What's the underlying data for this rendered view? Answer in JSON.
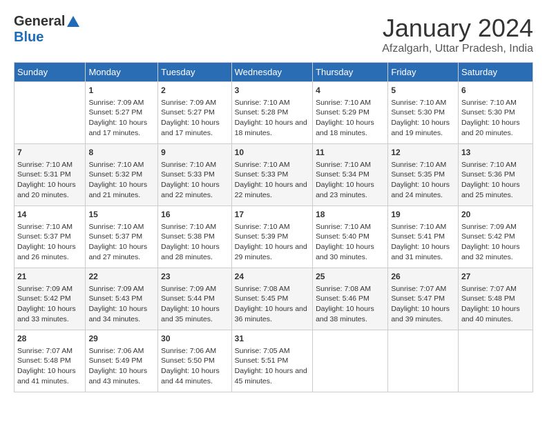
{
  "header": {
    "logo_general": "General",
    "logo_blue": "Blue",
    "title": "January 2024",
    "subtitle": "Afzalgarh, Uttar Pradesh, India"
  },
  "columns": [
    "Sunday",
    "Monday",
    "Tuesday",
    "Wednesday",
    "Thursday",
    "Friday",
    "Saturday"
  ],
  "weeks": [
    [
      {
        "day": "",
        "sunrise": "",
        "sunset": "",
        "daylight": ""
      },
      {
        "day": "1",
        "sunrise": "Sunrise: 7:09 AM",
        "sunset": "Sunset: 5:27 PM",
        "daylight": "Daylight: 10 hours and 17 minutes."
      },
      {
        "day": "2",
        "sunrise": "Sunrise: 7:09 AM",
        "sunset": "Sunset: 5:27 PM",
        "daylight": "Daylight: 10 hours and 17 minutes."
      },
      {
        "day": "3",
        "sunrise": "Sunrise: 7:10 AM",
        "sunset": "Sunset: 5:28 PM",
        "daylight": "Daylight: 10 hours and 18 minutes."
      },
      {
        "day": "4",
        "sunrise": "Sunrise: 7:10 AM",
        "sunset": "Sunset: 5:29 PM",
        "daylight": "Daylight: 10 hours and 18 minutes."
      },
      {
        "day": "5",
        "sunrise": "Sunrise: 7:10 AM",
        "sunset": "Sunset: 5:30 PM",
        "daylight": "Daylight: 10 hours and 19 minutes."
      },
      {
        "day": "6",
        "sunrise": "Sunrise: 7:10 AM",
        "sunset": "Sunset: 5:30 PM",
        "daylight": "Daylight: 10 hours and 20 minutes."
      }
    ],
    [
      {
        "day": "7",
        "sunrise": "Sunrise: 7:10 AM",
        "sunset": "Sunset: 5:31 PM",
        "daylight": "Daylight: 10 hours and 20 minutes."
      },
      {
        "day": "8",
        "sunrise": "Sunrise: 7:10 AM",
        "sunset": "Sunset: 5:32 PM",
        "daylight": "Daylight: 10 hours and 21 minutes."
      },
      {
        "day": "9",
        "sunrise": "Sunrise: 7:10 AM",
        "sunset": "Sunset: 5:33 PM",
        "daylight": "Daylight: 10 hours and 22 minutes."
      },
      {
        "day": "10",
        "sunrise": "Sunrise: 7:10 AM",
        "sunset": "Sunset: 5:33 PM",
        "daylight": "Daylight: 10 hours and 22 minutes."
      },
      {
        "day": "11",
        "sunrise": "Sunrise: 7:10 AM",
        "sunset": "Sunset: 5:34 PM",
        "daylight": "Daylight: 10 hours and 23 minutes."
      },
      {
        "day": "12",
        "sunrise": "Sunrise: 7:10 AM",
        "sunset": "Sunset: 5:35 PM",
        "daylight": "Daylight: 10 hours and 24 minutes."
      },
      {
        "day": "13",
        "sunrise": "Sunrise: 7:10 AM",
        "sunset": "Sunset: 5:36 PM",
        "daylight": "Daylight: 10 hours and 25 minutes."
      }
    ],
    [
      {
        "day": "14",
        "sunrise": "Sunrise: 7:10 AM",
        "sunset": "Sunset: 5:37 PM",
        "daylight": "Daylight: 10 hours and 26 minutes."
      },
      {
        "day": "15",
        "sunrise": "Sunrise: 7:10 AM",
        "sunset": "Sunset: 5:37 PM",
        "daylight": "Daylight: 10 hours and 27 minutes."
      },
      {
        "day": "16",
        "sunrise": "Sunrise: 7:10 AM",
        "sunset": "Sunset: 5:38 PM",
        "daylight": "Daylight: 10 hours and 28 minutes."
      },
      {
        "day": "17",
        "sunrise": "Sunrise: 7:10 AM",
        "sunset": "Sunset: 5:39 PM",
        "daylight": "Daylight: 10 hours and 29 minutes."
      },
      {
        "day": "18",
        "sunrise": "Sunrise: 7:10 AM",
        "sunset": "Sunset: 5:40 PM",
        "daylight": "Daylight: 10 hours and 30 minutes."
      },
      {
        "day": "19",
        "sunrise": "Sunrise: 7:10 AM",
        "sunset": "Sunset: 5:41 PM",
        "daylight": "Daylight: 10 hours and 31 minutes."
      },
      {
        "day": "20",
        "sunrise": "Sunrise: 7:09 AM",
        "sunset": "Sunset: 5:42 PM",
        "daylight": "Daylight: 10 hours and 32 minutes."
      }
    ],
    [
      {
        "day": "21",
        "sunrise": "Sunrise: 7:09 AM",
        "sunset": "Sunset: 5:42 PM",
        "daylight": "Daylight: 10 hours and 33 minutes."
      },
      {
        "day": "22",
        "sunrise": "Sunrise: 7:09 AM",
        "sunset": "Sunset: 5:43 PM",
        "daylight": "Daylight: 10 hours and 34 minutes."
      },
      {
        "day": "23",
        "sunrise": "Sunrise: 7:09 AM",
        "sunset": "Sunset: 5:44 PM",
        "daylight": "Daylight: 10 hours and 35 minutes."
      },
      {
        "day": "24",
        "sunrise": "Sunrise: 7:08 AM",
        "sunset": "Sunset: 5:45 PM",
        "daylight": "Daylight: 10 hours and 36 minutes."
      },
      {
        "day": "25",
        "sunrise": "Sunrise: 7:08 AM",
        "sunset": "Sunset: 5:46 PM",
        "daylight": "Daylight: 10 hours and 38 minutes."
      },
      {
        "day": "26",
        "sunrise": "Sunrise: 7:07 AM",
        "sunset": "Sunset: 5:47 PM",
        "daylight": "Daylight: 10 hours and 39 minutes."
      },
      {
        "day": "27",
        "sunrise": "Sunrise: 7:07 AM",
        "sunset": "Sunset: 5:48 PM",
        "daylight": "Daylight: 10 hours and 40 minutes."
      }
    ],
    [
      {
        "day": "28",
        "sunrise": "Sunrise: 7:07 AM",
        "sunset": "Sunset: 5:48 PM",
        "daylight": "Daylight: 10 hours and 41 minutes."
      },
      {
        "day": "29",
        "sunrise": "Sunrise: 7:06 AM",
        "sunset": "Sunset: 5:49 PM",
        "daylight": "Daylight: 10 hours and 43 minutes."
      },
      {
        "day": "30",
        "sunrise": "Sunrise: 7:06 AM",
        "sunset": "Sunset: 5:50 PM",
        "daylight": "Daylight: 10 hours and 44 minutes."
      },
      {
        "day": "31",
        "sunrise": "Sunrise: 7:05 AM",
        "sunset": "Sunset: 5:51 PM",
        "daylight": "Daylight: 10 hours and 45 minutes."
      },
      {
        "day": "",
        "sunrise": "",
        "sunset": "",
        "daylight": ""
      },
      {
        "day": "",
        "sunrise": "",
        "sunset": "",
        "daylight": ""
      },
      {
        "day": "",
        "sunrise": "",
        "sunset": "",
        "daylight": ""
      }
    ]
  ]
}
